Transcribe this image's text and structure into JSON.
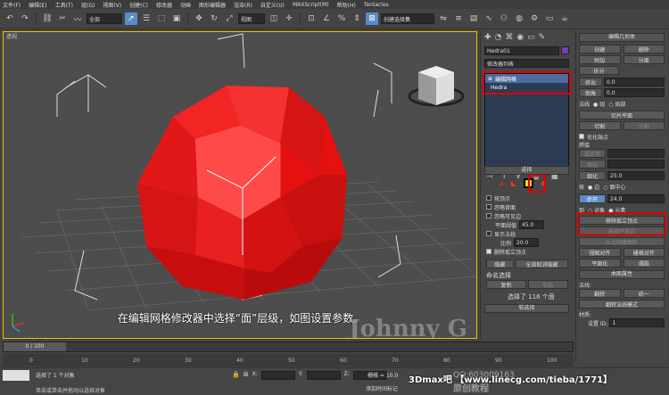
{
  "menubar": {
    "items": [
      "文件(F)",
      "编辑(E)",
      "工具(T)",
      "组(G)",
      "视图(V)",
      "创建(C)",
      "修改器",
      "动画",
      "图形编辑器",
      "渲染(R)",
      "自定义(U)",
      "MAXScript(M)",
      "帮助(H)",
      "Tentacles"
    ]
  },
  "toolbar": {
    "selection_filter": "全部",
    "view_dropdown": "视图",
    "named_selection": "创建选择集"
  },
  "viewport": {
    "label": "透视",
    "subtitle": "在编辑网格修改器中选择“面”层级，如图设置参数。",
    "watermark": "Johnny G"
  },
  "command_panel": {
    "object_name": "Hedra01",
    "modifier_list": "修改器列表",
    "stack": [
      {
        "label": "编辑网格",
        "selected": true
      },
      {
        "label": "Hedra",
        "selected": false
      }
    ],
    "selection_rollout": "选择",
    "checkboxes": [
      {
        "label": "按顶点",
        "on": false
      },
      {
        "label": "忽略背面",
        "on": false
      },
      {
        "label": "忽略可见边",
        "on": false
      },
      {
        "label": "显示法线",
        "on": false
      },
      {
        "label": "删除孤立顶点",
        "on": true
      }
    ],
    "planar_threshold_label": "平面阈值",
    "planar_threshold_value": "45.0",
    "scale_label": "比例",
    "scale_value": "20.0",
    "hide_button": "隐藏",
    "unhide_all_button": "全部取消隐藏",
    "named_selection_label": "命名选择",
    "copy_button": "复制",
    "paste_button": "粘贴",
    "selected_status": "选择了 116 个面",
    "soft_selection": "软选择"
  },
  "edit_geometry": {
    "header": "编辑几何体",
    "create": "创建",
    "delete": "删除",
    "attach": "附加",
    "detach": "分离",
    "break": "拆分",
    "extrude_label": "挤出",
    "extrude_value": "0.0",
    "bevel_label": "倒角",
    "bevel_value": "0.0",
    "normal_label": "法线",
    "group_label": "组",
    "local_label": "局部",
    "slice_plane": "切片平面",
    "slice": "切割",
    "divide": "分割",
    "optimize_end": "优化端点",
    "weld_label": "焊接",
    "selected_btn": "选定项",
    "target_btn": "目标",
    "tessellate_label": "细化",
    "tessellate_value": "25.0",
    "by_label": "按",
    "edge_label": "边",
    "face_center_label": "面中心",
    "explode_btn": "炸开",
    "explode_value": "24.0",
    "to_label": "到",
    "object_label": "对象",
    "elements_label": "元素",
    "remove_isolated": "移除孤立顶点",
    "select_open_edges": "选择开放边",
    "create_shape": "从边创建图形",
    "view_align": "视图对齐",
    "grid_align": "栅格对齐",
    "planarize": "平面化",
    "collapse": "塌陷",
    "surface_props": "曲面属性",
    "normals_label": "法线:",
    "flip": "翻转",
    "unify": "统一",
    "flip_normal_mode": "翻转法线模式",
    "material_label": "材质:",
    "set_id_label": "设置 ID:",
    "set_id_value": "1"
  },
  "timeline": {
    "frame": "0 / 100",
    "ticks": [
      "0",
      "10",
      "20",
      "30",
      "40",
      "50",
      "60",
      "70",
      "80",
      "90",
      "100"
    ]
  },
  "status": {
    "selection": "选择了 1 个对象",
    "hint": "单击或单击并拖动以选择对象",
    "add_time_tag": "添加时间标记",
    "grid_label": "栅格 = 10.0",
    "qq": "QQ:603009163",
    "course": "原创教程",
    "url": "3Dmax吧 【www.linecg.com/tieba/1771】"
  },
  "colors": {
    "accent": "#e00000",
    "object_red": "#ee1111",
    "selection_blue": "#4d6da0",
    "highlight_yellow": "#f0c000",
    "object_color_swatch": "#7040c0"
  }
}
